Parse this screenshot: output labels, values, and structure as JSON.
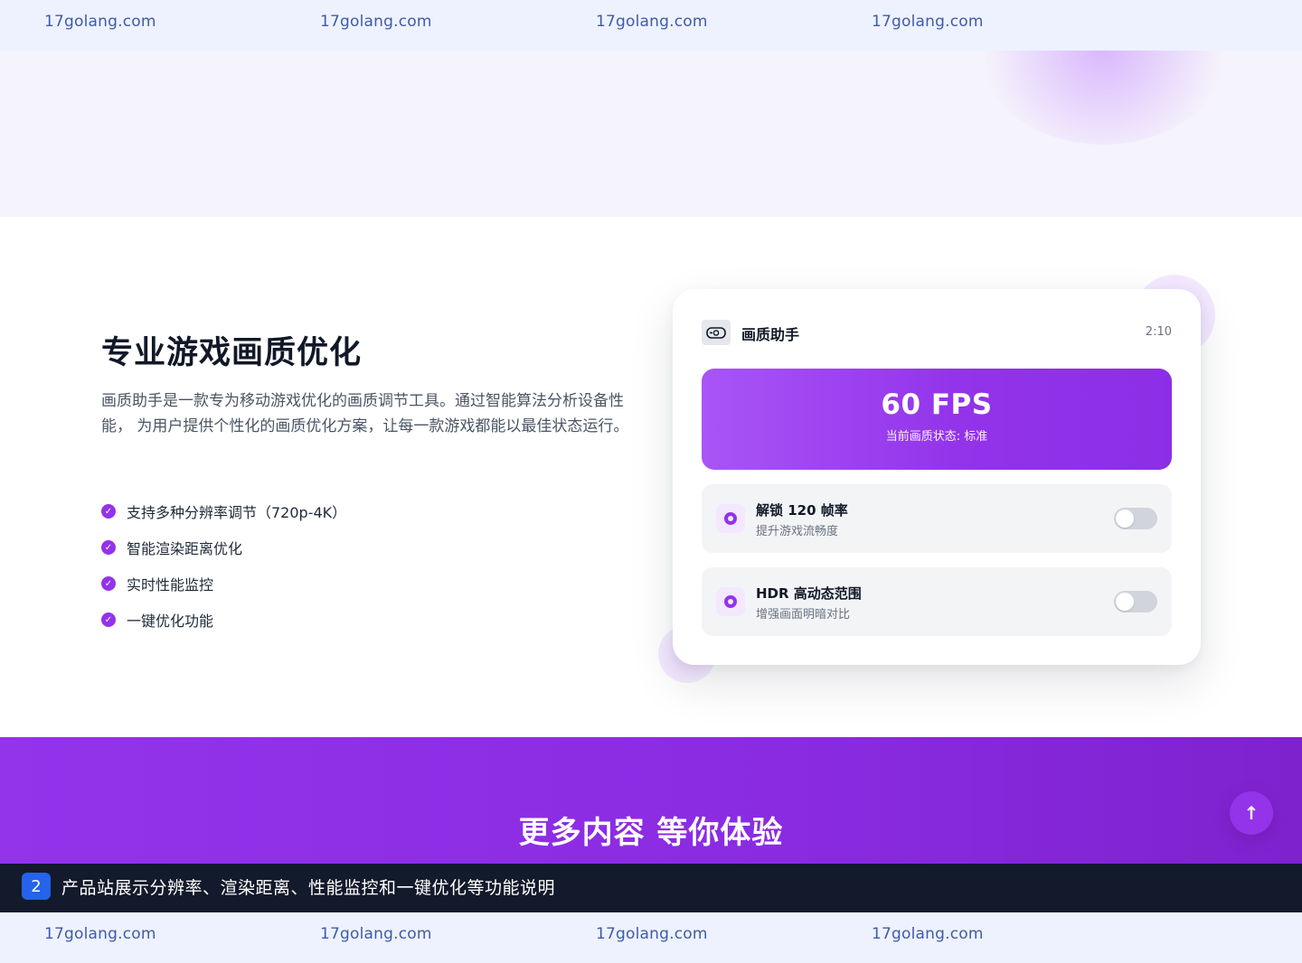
{
  "watermark": {
    "items": [
      "17golang.com",
      "17golang.com",
      "17golang.com",
      "17golang.com"
    ]
  },
  "feature": {
    "title": "专业游戏画质优化",
    "description": "画质助手是一款专为移动游戏优化的画质调节工具。通过智能算法分析设备性能， 为用户提供个性化的画质优化方案，让每一款游戏都能以最佳状态运行。",
    "list": [
      "支持多种分辨率调节（720p-4K）",
      "智能渲染距离优化",
      "实时性能监控",
      "一键优化功能"
    ]
  },
  "app_card": {
    "icon": "gamepad-icon",
    "name": "画质助手",
    "time": "2:10",
    "fps_value": "60 FPS",
    "fps_status": "当前画质状态: 标准",
    "options": [
      {
        "icon": "gauge-icon",
        "title": "解锁 120 帧率",
        "subtitle": "提升游戏流畅度",
        "enabled": false
      },
      {
        "icon": "palette-icon",
        "title": "HDR 高动态范围",
        "subtitle": "增强画面明暗对比",
        "enabled": false
      }
    ]
  },
  "cta": {
    "title": "更多内容 等你体验"
  },
  "caption": {
    "badge": "2",
    "text": "产品站展示分辨率、渲染距离、性能监控和一键优化等功能说明"
  },
  "colors": {
    "accent": "#9333ea",
    "accent_light": "#a855f7",
    "watermark_bg": "#eef2ff",
    "watermark_text": "#3f5ba8",
    "caption_bg": "#131a2b",
    "badge": "#2563eb"
  }
}
